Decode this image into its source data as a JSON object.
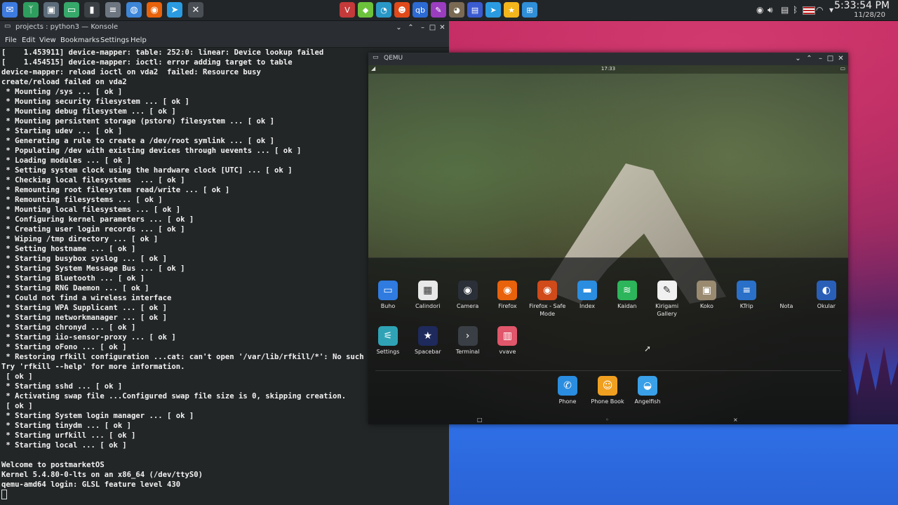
{
  "panel": {
    "tasks": [
      {
        "name": "thunderbird-icon",
        "glyph": "✉",
        "color": "#3d7be0"
      },
      {
        "name": "app-icon-green",
        "glyph": "ᛉ",
        "color": "#2e9e5e"
      },
      {
        "name": "shopping-bag-icon",
        "glyph": "▣",
        "color": "#5d6c7a"
      },
      {
        "name": "folder-icon",
        "glyph": "▭",
        "color": "#36a86a"
      },
      {
        "name": "terminal-icon",
        "glyph": "▮",
        "color": "#3b4045"
      },
      {
        "name": "notes-icon",
        "glyph": "≡",
        "color": "#6d7680"
      },
      {
        "name": "globe-icon",
        "glyph": "◍",
        "color": "#3d86d8"
      },
      {
        "name": "firefox-icon",
        "glyph": "◉",
        "color": "#e8620b"
      },
      {
        "name": "telegram-icon",
        "glyph": "➤",
        "color": "#2a9be0"
      },
      {
        "name": "close-app-icon",
        "glyph": "✕",
        "color": "#4a4f55"
      }
    ],
    "tray_apps": [
      {
        "name": "vivaldi-icon",
        "glyph": "V",
        "color": "#c43a3a"
      },
      {
        "name": "cube-icon",
        "glyph": "◆",
        "color": "#6cc23b"
      },
      {
        "name": "speedometer-icon",
        "glyph": "◔",
        "color": "#2a98c7"
      },
      {
        "name": "owl-icon",
        "glyph": "☻",
        "color": "#e04a1b"
      },
      {
        "name": "qbittorrent-icon",
        "glyph": "qb",
        "color": "#2d6bd4"
      },
      {
        "name": "pen-icon",
        "glyph": "✎",
        "color": "#9a3dbf"
      },
      {
        "name": "gimp-icon",
        "glyph": "◕",
        "color": "#7a6a54"
      },
      {
        "name": "document-icon",
        "glyph": "▤",
        "color": "#3b5bd1"
      },
      {
        "name": "telegram-tray-icon",
        "glyph": "➤",
        "color": "#2a9be0"
      },
      {
        "name": "star-icon",
        "glyph": "★",
        "color": "#f2b51b"
      },
      {
        "name": "calculator-icon",
        "glyph": "⊞",
        "color": "#2f8fd8"
      }
    ],
    "clock_time": "5:33:54 PM",
    "clock_date": "11/28/20"
  },
  "konsole": {
    "title": "projects : python3 — Konsole",
    "menu": [
      "File",
      "Edit",
      "View",
      "Bookmarks",
      "Settings",
      "Help"
    ],
    "lines": [
      "[    1.453911] device-mapper: table: 252:0: linear: Device lookup failed",
      "[    1.454515] device-mapper: ioctl: error adding target to table",
      "device-mapper: reload ioctl on vda2  failed: Resource busy",
      "create/reload failed on vda2",
      " * Mounting /sys ... [ ok ]",
      " * Mounting security filesystem ... [ ok ]",
      " * Mounting debug filesystem ... [ ok ]",
      " * Mounting persistent storage (pstore) filesystem ... [ ok ]",
      " * Starting udev ... [ ok ]",
      " * Generating a rule to create a /dev/root symlink ... [ ok ]",
      " * Populating /dev with existing devices through uevents ... [ ok ]",
      " * Loading modules ... [ ok ]",
      " * Setting system clock using the hardware clock [UTC] ... [ ok ]",
      " * Checking local filesystems  ... [ ok ]",
      " * Remounting root filesystem read/write ... [ ok ]",
      " * Remounting filesystems ... [ ok ]",
      " * Mounting local filesystems ... [ ok ]",
      " * Configuring kernel parameters ... [ ok ]",
      " * Creating user login records ... [ ok ]",
      " * Wiping /tmp directory ... [ ok ]",
      " * Setting hostname ... [ ok ]",
      " * Starting busybox syslog ... [ ok ]",
      " * Starting System Message Bus ... [ ok ]",
      " * Starting Bluetooth ... [ ok ]",
      " * Starting RNG Daemon ... [ ok ]",
      " * Could not find a wireless interface",
      " * Starting WPA Supplicant ... [ ok ]",
      " * Starting networkmanager ... [ ok ]",
      " * Starting chronyd ... [ ok ]",
      " * Starting iio-sensor-proxy ... [ ok ]",
      " * Starting oFono ... [ ok ]",
      " * Restoring rfkill configuration ...cat: can't open '/var/lib/rfkill/*': No such file",
      "Try 'rfkill --help' for more information.",
      " [ ok ]",
      " * Starting sshd ... [ ok ]",
      " * Activating swap file ...Configured swap file size is 0, skipping creation.",
      " [ ok ]",
      " * Starting System login manager ... [ ok ]",
      " * Starting tinydm ... [ ok ]",
      " * Starting urfkill ... [ ok ]",
      " * Starting local ... [ ok ]",
      "",
      "Welcome to postmarketOS",
      "Kernel 5.4.80-0-lts on an x86_64 (/dev/ttyS0)",
      "qemu-amd64 login: GLSL feature level 430"
    ]
  },
  "qemu": {
    "title": "QEMU",
    "status_time": "17:33",
    "apps_row1": [
      {
        "label": "Buho",
        "name": "buho-icon",
        "glyph": "▭",
        "color": "#2f7be0"
      },
      {
        "label": "Calindori",
        "name": "calendar-icon",
        "glyph": "▦",
        "color": "#e8e8e8"
      },
      {
        "label": "Camera",
        "name": "camera-icon",
        "glyph": "◉",
        "color": "#2b3038"
      },
      {
        "label": "Firefox",
        "name": "firefox-app-icon",
        "glyph": "◉",
        "color": "#e8620b"
      },
      {
        "label": "Firefox - Safe Mode",
        "name": "firefox-safe-icon",
        "glyph": "◉",
        "color": "#d04a1a"
      },
      {
        "label": "Index",
        "name": "index-folder-icon",
        "glyph": "▬",
        "color": "#2a8de0"
      },
      {
        "label": "Kaidan",
        "name": "kaidan-icon",
        "glyph": "≋",
        "color": "#2cb55a"
      },
      {
        "label": "Kirigami Gallery",
        "name": "kirigami-icon",
        "glyph": "✎",
        "color": "#f0f0f0"
      },
      {
        "label": "Koko",
        "name": "koko-icon",
        "glyph": "▣",
        "color": "#9a8a70"
      },
      {
        "label": "KTrip",
        "name": "ktrip-icon",
        "glyph": "≡",
        "color": "#2a70c8"
      },
      {
        "label": "Nota",
        "name": "nota-icon",
        "glyph": "",
        "color": "transparent"
      },
      {
        "label": "Okular",
        "name": "okular-icon",
        "glyph": "◐",
        "color": "#2a5fb8"
      }
    ],
    "apps_row2": [
      {
        "label": "Settings",
        "name": "settings-app-icon",
        "glyph": "⚟",
        "color": "#2fa3b5"
      },
      {
        "label": "Spacebar",
        "name": "spacebar-icon",
        "glyph": "★",
        "color": "#1e2a5c"
      },
      {
        "label": "Terminal",
        "name": "terminal-app-icon",
        "glyph": "›",
        "color": "#3a3f45"
      },
      {
        "label": "vvave",
        "name": "vvave-icon",
        "glyph": "▥",
        "color": "#e0566a"
      }
    ],
    "dock": [
      {
        "label": "Phone",
        "name": "phone-icon",
        "glyph": "✆",
        "color": "#2a8de0"
      },
      {
        "label": "Phone Book",
        "name": "phone-book-icon",
        "glyph": "☺",
        "color": "#f0a020"
      },
      {
        "label": "Angelfish",
        "name": "angelfish-icon",
        "glyph": "◒",
        "color": "#3aa0e8"
      }
    ]
  }
}
